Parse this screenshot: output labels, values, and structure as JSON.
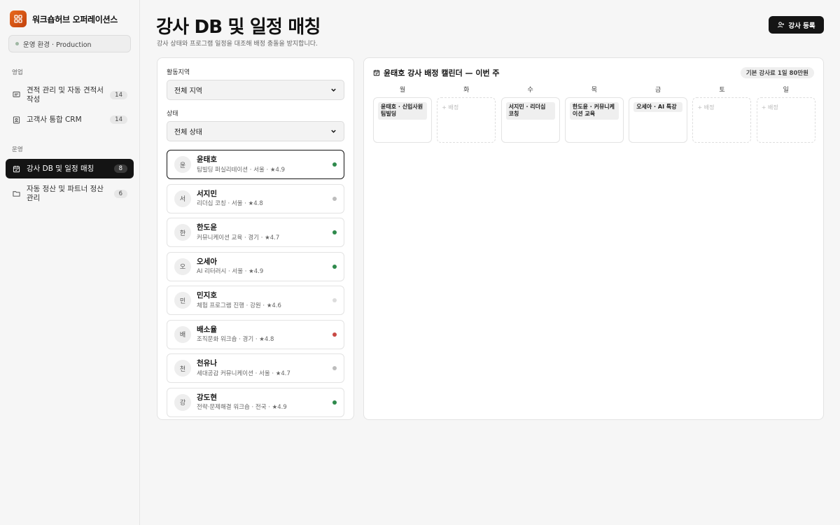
{
  "brand": {
    "name": "워크숍허브 오퍼레이션스"
  },
  "env": {
    "label": "운영 환경 · Production"
  },
  "sidebar": {
    "sections": [
      {
        "label": "영업",
        "items": [
          {
            "label": "견적 관리 및 자동 견적서 작성",
            "badge": "14",
            "icon": "message-square-icon"
          },
          {
            "label": "고객사 통합 CRM",
            "badge": "14",
            "icon": "contact-card-icon"
          }
        ]
      },
      {
        "label": "운영",
        "items": [
          {
            "label": "강사 DB 및 일정 매칭",
            "badge": "8",
            "icon": "calendar-check-icon",
            "active": true
          },
          {
            "label": "자동 정산 및 파트너 정산관리",
            "badge": "6",
            "icon": "folder-icon"
          }
        ]
      }
    ]
  },
  "header": {
    "title": "강사 DB 및 일정 매칭",
    "subtitle": "강사 상태와 프로그램 일정을 대조해 배정 충돌을 방지합니다.",
    "register_button": "강사 등록"
  },
  "filters": {
    "region_label": "활동지역",
    "region_value": "전체 지역",
    "status_label": "상태",
    "status_value": "전체 상태"
  },
  "instructors": [
    {
      "initial": "윤",
      "name": "윤태호",
      "meta": "팀빌딩 퍼실리테이션 · 서울 · ★4.9",
      "status_color": "#2f8a4c",
      "selected": true
    },
    {
      "initial": "서",
      "name": "서지민",
      "meta": "리더십 코칭 · 서울 · ★4.8",
      "status_color": "#bdbdbd"
    },
    {
      "initial": "한",
      "name": "한도윤",
      "meta": "커뮤니케이션 교육 · 경기 · ★4.7",
      "status_color": "#2f8a4c"
    },
    {
      "initial": "오",
      "name": "오세아",
      "meta": "AI 리터러시 · 서울 · ★4.9",
      "status_color": "#2f8a4c"
    },
    {
      "initial": "민",
      "name": "민지호",
      "meta": "체험 프로그램 진행 · 강원 · ★4.6",
      "status_color": "#dcdcdc"
    },
    {
      "initial": "배",
      "name": "배소율",
      "meta": "조직문화 워크숍 · 경기 · ★4.8",
      "status_color": "#c94a45"
    },
    {
      "initial": "천",
      "name": "천유나",
      "meta": "세대공감 커뮤니케이션 · 서울 · ★4.7",
      "status_color": "#bdbdbd"
    },
    {
      "initial": "강",
      "name": "강도현",
      "meta": "전략·문제해결 워크숍 · 전국 · ★4.9",
      "status_color": "#2f8a4c"
    }
  ],
  "calendar": {
    "title": "윤태호 강사 배정 캘린더 — 이번 주",
    "rate_chip": "기본 강사료 1일 80만원",
    "days": [
      "월",
      "화",
      "수",
      "목",
      "금",
      "토",
      "일"
    ],
    "cells": [
      {
        "booking": "윤태호 · 신입사원 팀빌딩"
      },
      {
        "empty": "+ 배정"
      },
      {
        "booking": "서지민 · 리더십 코칭"
      },
      {
        "booking": "한도윤 · 커뮤니케이션 교육"
      },
      {
        "booking": "오세아 · AI 특강"
      },
      {
        "empty": "+ 배정"
      },
      {
        "empty": "+ 배정"
      }
    ]
  }
}
